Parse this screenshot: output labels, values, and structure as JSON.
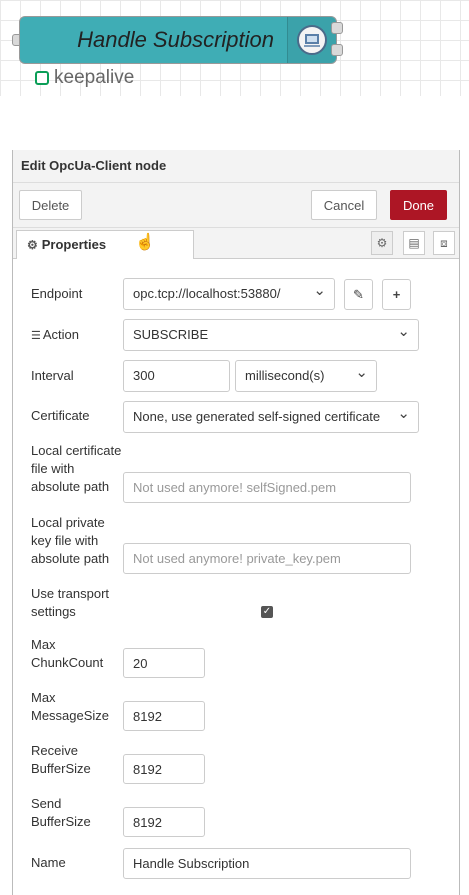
{
  "node": {
    "label": "Handle Subscription",
    "status_text": "keepalive",
    "color": "#3fadb5",
    "status_color": "#0b9e57",
    "icon": "opcua-icon"
  },
  "tray": {
    "title": "Edit OpcUa-Client node",
    "delete_label": "Delete",
    "cancel_label": "Cancel",
    "done_label": "Done",
    "properties_tab": "Properties",
    "tab_icons": [
      "gear-icon",
      "description-icon",
      "appearance-icon"
    ]
  },
  "form": {
    "endpoint": {
      "label": "Endpoint",
      "value": "opc.tcp://localhost:53880/"
    },
    "action": {
      "label": "Action",
      "value": "SUBSCRIBE"
    },
    "interval": {
      "label": "Interval",
      "value": "300",
      "unit": "millisecond(s)"
    },
    "certificate": {
      "label": "Certificate",
      "value": "None, use generated self-signed certificate"
    },
    "local_cert": {
      "label_lines": [
        "Local certificate",
        "file with",
        "absolute path"
      ],
      "placeholder": "Not used anymore! selfSigned.pem"
    },
    "local_key": {
      "label_lines": [
        "Local private",
        "key file with",
        "absolute path"
      ],
      "placeholder": "Not used anymore! private_key.pem"
    },
    "transport": {
      "label_lines": [
        "Use transport",
        "settings"
      ],
      "checked": true
    },
    "max_chunk": {
      "label_lines": [
        "Max",
        "ChunkCount"
      ],
      "value": "20"
    },
    "max_message": {
      "label_lines": [
        "Max",
        "MessageSize"
      ],
      "value": "8192"
    },
    "receive_buffer": {
      "label_lines": [
        "Receive",
        "BufferSize"
      ],
      "value": "8192"
    },
    "send_buffer": {
      "label_lines": [
        "Send",
        "BufferSize"
      ],
      "value": "8192"
    },
    "name": {
      "label": "Name",
      "value": "Handle Subscription"
    }
  },
  "colors": {
    "done_button": "#ad1625"
  }
}
